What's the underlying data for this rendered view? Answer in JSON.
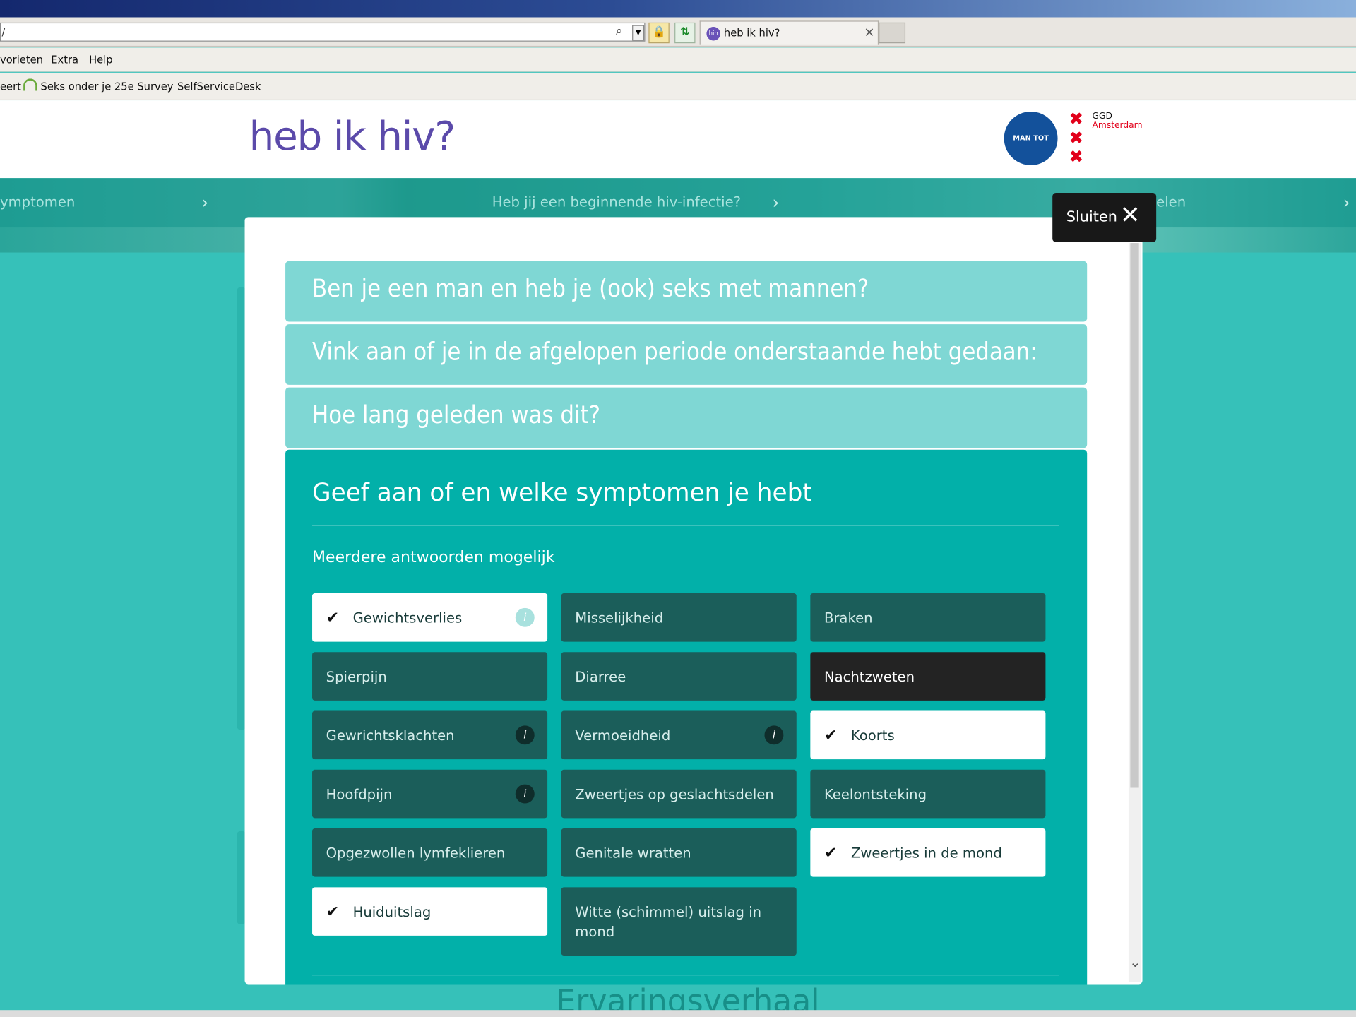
{
  "browser": {
    "address": "/",
    "tab_title": "heb ik hiv?",
    "tab_close": "×",
    "tab_favicon": "hih",
    "menu": [
      "vorieten",
      "Extra",
      "Help"
    ],
    "favorites": [
      "eert",
      "Seks onder je 25e Survey",
      "SelfServiceDesk"
    ]
  },
  "site": {
    "logo_text": "heb ik hiv?",
    "mvm_logo": "MAN TOT MAN",
    "ggd_x": "✖",
    "ggd_name": "GGD",
    "ggd_city": "Amsterdam"
  },
  "nav": {
    "items": [
      "ymptomen",
      "Heb jij een beginnende hiv-infectie?",
      "elen"
    ]
  },
  "modal": {
    "close_label": "Sluiten",
    "accordion": [
      "Ben je een man en heb je (ook) seks met mannen?",
      "Vink aan of je in de afgelopen periode onderstaande hebt gedaan:",
      "Hoe lang geleden was dit?"
    ],
    "open_title": "Geef aan of en welke symptomen je hebt",
    "hint": "Meerdere antwoorden mogelijk",
    "options": [
      {
        "label": "Gewichtsverlies",
        "checked": true,
        "info": true
      },
      {
        "label": "Misselijkheid",
        "checked": false,
        "info": false
      },
      {
        "label": "Braken",
        "checked": false,
        "info": false
      },
      {
        "label": "Spierpijn",
        "checked": false,
        "info": false
      },
      {
        "label": "Diarree",
        "checked": false,
        "info": false
      },
      {
        "label": "Nachtzweten",
        "checked": false,
        "info": false,
        "hover": true
      },
      {
        "label": "Gewrichtsklachten",
        "checked": false,
        "info": true
      },
      {
        "label": "Vermoeidheid",
        "checked": false,
        "info": true
      },
      {
        "label": "Koorts",
        "checked": true,
        "info": false
      },
      {
        "label": "Hoofdpijn",
        "checked": false,
        "info": true
      },
      {
        "label": "Zweertjes op geslachtsdelen",
        "checked": false,
        "info": false
      },
      {
        "label": "Keelontsteking",
        "checked": false,
        "info": false
      },
      {
        "label": "Opgezwollen lymfeklieren",
        "checked": false,
        "info": false
      },
      {
        "label": "Genitale wratten",
        "checked": false,
        "info": false
      },
      {
        "label": "Zweertjes in de mond",
        "checked": true,
        "info": false
      },
      {
        "label": "Huiduitslag",
        "checked": true,
        "info": false
      },
      {
        "label": "Witte (schimmel) uitslag in mond",
        "checked": false,
        "info": false
      }
    ],
    "check_glyph": "✔",
    "info_glyph": "i"
  },
  "page": {
    "bottom_heading": "Ervaringsverhaal"
  },
  "colors": {
    "accent": "#02b0a9",
    "accordion_closed": "#7fd7d4",
    "option_dark": "#1b5e5a",
    "brand_purple": "#5b4aaa"
  }
}
